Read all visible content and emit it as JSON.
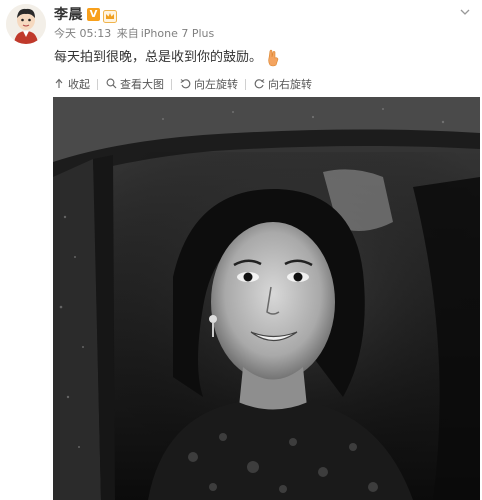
{
  "user": {
    "name": "李晨",
    "vip_badge": "V",
    "avatar_icon": "cartoon-avatar-icon"
  },
  "post": {
    "time": "今天 05:13",
    "source_prefix": "来自",
    "device": "iPhone 7 Plus",
    "text": "每天拍到很晚，总是收到你的鼓励。",
    "emoji_icon": "hand-emoji-icon"
  },
  "toolbar": {
    "collapse": "收起",
    "view_large": "查看大图",
    "rotate_left": "向左旋转",
    "rotate_right": "向右旋转"
  },
  "colors": {
    "accent": "#f8a01c",
    "text": "#333333",
    "muted": "#808080"
  },
  "image": {
    "subject": "black-and-white portrait photo in car window",
    "icon": "photo-image"
  }
}
